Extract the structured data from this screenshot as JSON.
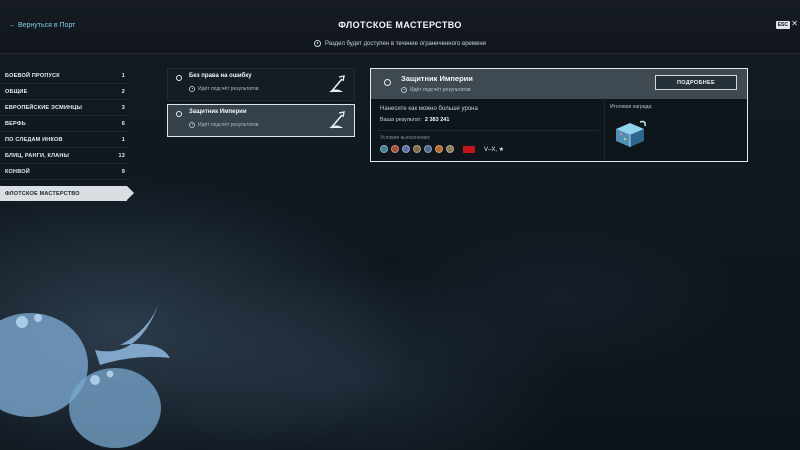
{
  "header": {
    "back_label": "← Вернуться в Порт",
    "title": "ФЛОТСКОЕ МАСТЕРСТВО",
    "notice": "Раздел будет доступен в течение ограниченного времени",
    "esc_label": "ESC",
    "close_glyph": "✕"
  },
  "sidebar": {
    "items": [
      {
        "label": "БОЕВОЙ ПРОПУСК",
        "count": "1"
      },
      {
        "label": "ОБЩИЕ",
        "count": "2"
      },
      {
        "label": "ЕВРОПЕЙСКИЕ ЭСМИНЦЫ",
        "count": "3"
      },
      {
        "label": "ВЕРФЬ",
        "count": "6"
      },
      {
        "label": "ПО СЛЕДАМ ИНКОВ",
        "count": "1"
      },
      {
        "label": "БЛИЦ, РАНГИ, КЛАНЫ",
        "count": "13"
      },
      {
        "label": "КОНВОЙ",
        "count": "9"
      }
    ],
    "active_label": "ФЛОТСКОЕ МАСТЕРСТВО"
  },
  "cards": [
    {
      "title": "Без права на ошибку",
      "status": "Идёт подсчёт результатов",
      "icon": "trident-icon"
    },
    {
      "title": "Защитник Империи",
      "status": "Идёт подсчёт результатов",
      "icon": "trident-icon"
    }
  ],
  "detail": {
    "title": "Защитник Империи",
    "status": "Идёт подсчёт результатов",
    "more_button": "ПОДРОБНЕЕ",
    "task": "Нанесите как можно больше урона",
    "result_label": "Ваша результат:",
    "result_value": "2 383 241",
    "conditions_label": "Условия выполнения:",
    "tiers": "V–X, ★",
    "reward_label": "Итоговая награда:",
    "nation_colors": [
      "#3f7f8f",
      "#a34b3a",
      "#5a6da8",
      "#7f6b4a",
      "#4b6a8c",
      "#b46a2a",
      "#8a7a55"
    ]
  },
  "colors": {
    "accent": "#7dd0e6",
    "flag_red": "#c4141a",
    "active_tab_bg": "#d9dee2"
  }
}
